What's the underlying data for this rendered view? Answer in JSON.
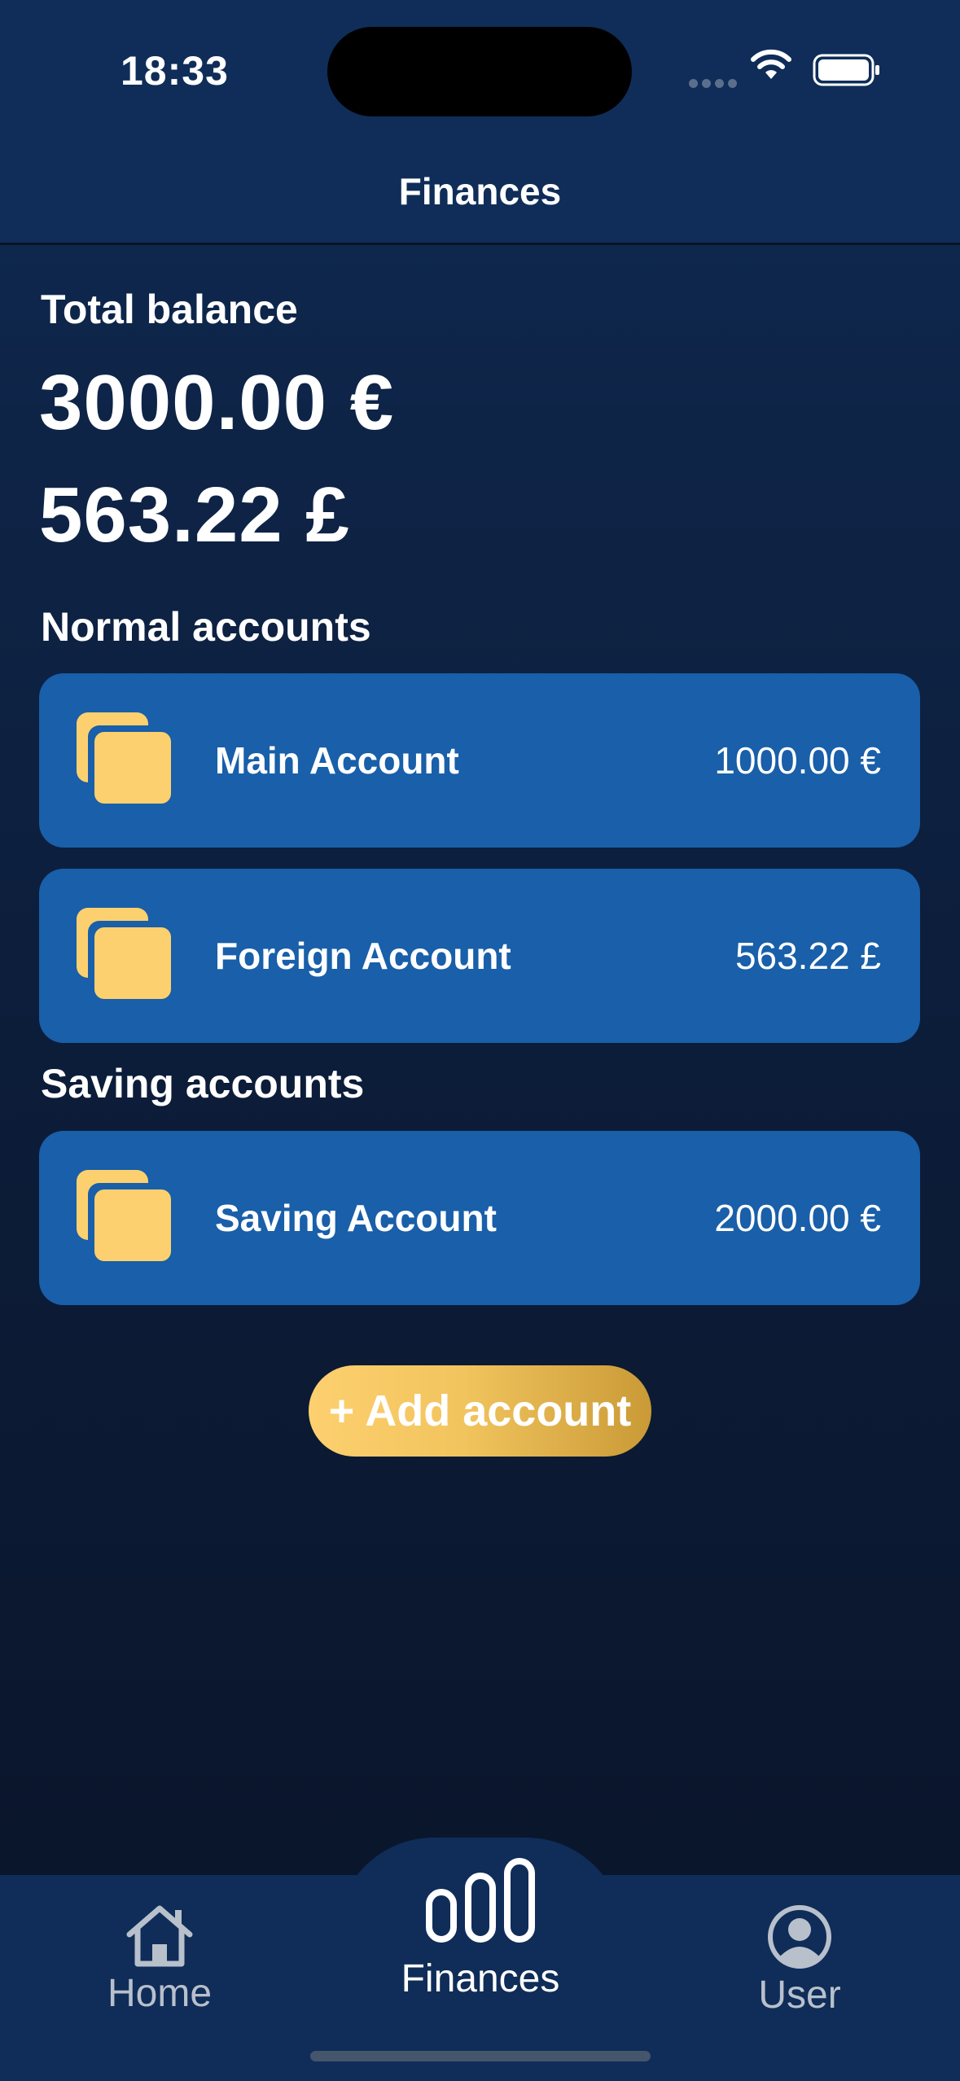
{
  "status_bar": {
    "time": "18:33"
  },
  "header": {
    "title": "Finances"
  },
  "balance": {
    "label": "Total balance",
    "amounts": [
      "3000.00 €",
      "563.22 £"
    ]
  },
  "normal_accounts": {
    "label": "Normal accounts",
    "items": [
      {
        "name": "Main Account",
        "balance": "1000.00 €"
      },
      {
        "name": "Foreign Account",
        "balance": "563.22 £"
      }
    ]
  },
  "saving_accounts": {
    "label": "Saving accounts",
    "items": [
      {
        "name": "Saving Account",
        "balance": "2000.00 €"
      }
    ]
  },
  "add_button": {
    "label": "+ Add account"
  },
  "tab_bar": {
    "tabs": [
      {
        "label": "Home",
        "icon": "home-icon",
        "active": false
      },
      {
        "label": "Finances",
        "icon": "bar-chart-icon",
        "active": true
      },
      {
        "label": "User",
        "icon": "user-icon",
        "active": false
      }
    ]
  },
  "colors": {
    "background_top": "#0f2b55",
    "background_bottom": "#0a1428",
    "card": "#195fa9",
    "accent": "#fdd06f",
    "accent_dark": "#c99a36"
  }
}
